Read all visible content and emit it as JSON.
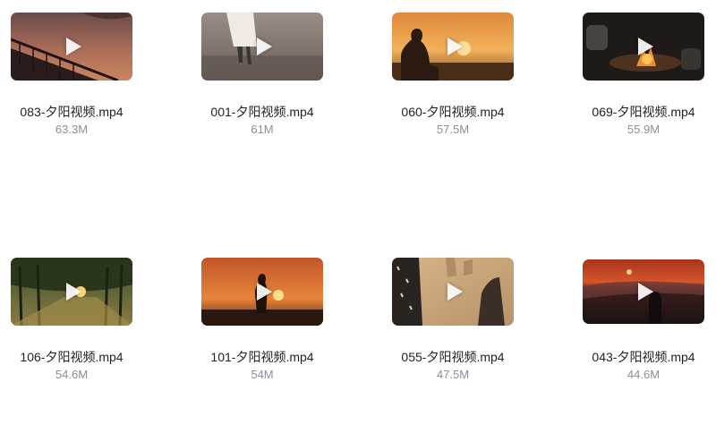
{
  "files": [
    {
      "name": "083-夕阳视频.mp4",
      "size": "63.3M"
    },
    {
      "name": "001-夕阳视频.mp4",
      "size": "61M"
    },
    {
      "name": "060-夕阳视频.mp4",
      "size": "57.5M"
    },
    {
      "name": "069-夕阳视频.mp4",
      "size": "55.9M"
    },
    {
      "name": "106-夕阳视频.mp4",
      "size": "54.6M"
    },
    {
      "name": "101-夕阳视频.mp4",
      "size": "54M"
    },
    {
      "name": "055-夕阳视频.mp4",
      "size": "47.5M"
    },
    {
      "name": "043-夕阳视频.mp4",
      "size": "44.6M"
    }
  ],
  "icons": {
    "play": "play-icon"
  }
}
